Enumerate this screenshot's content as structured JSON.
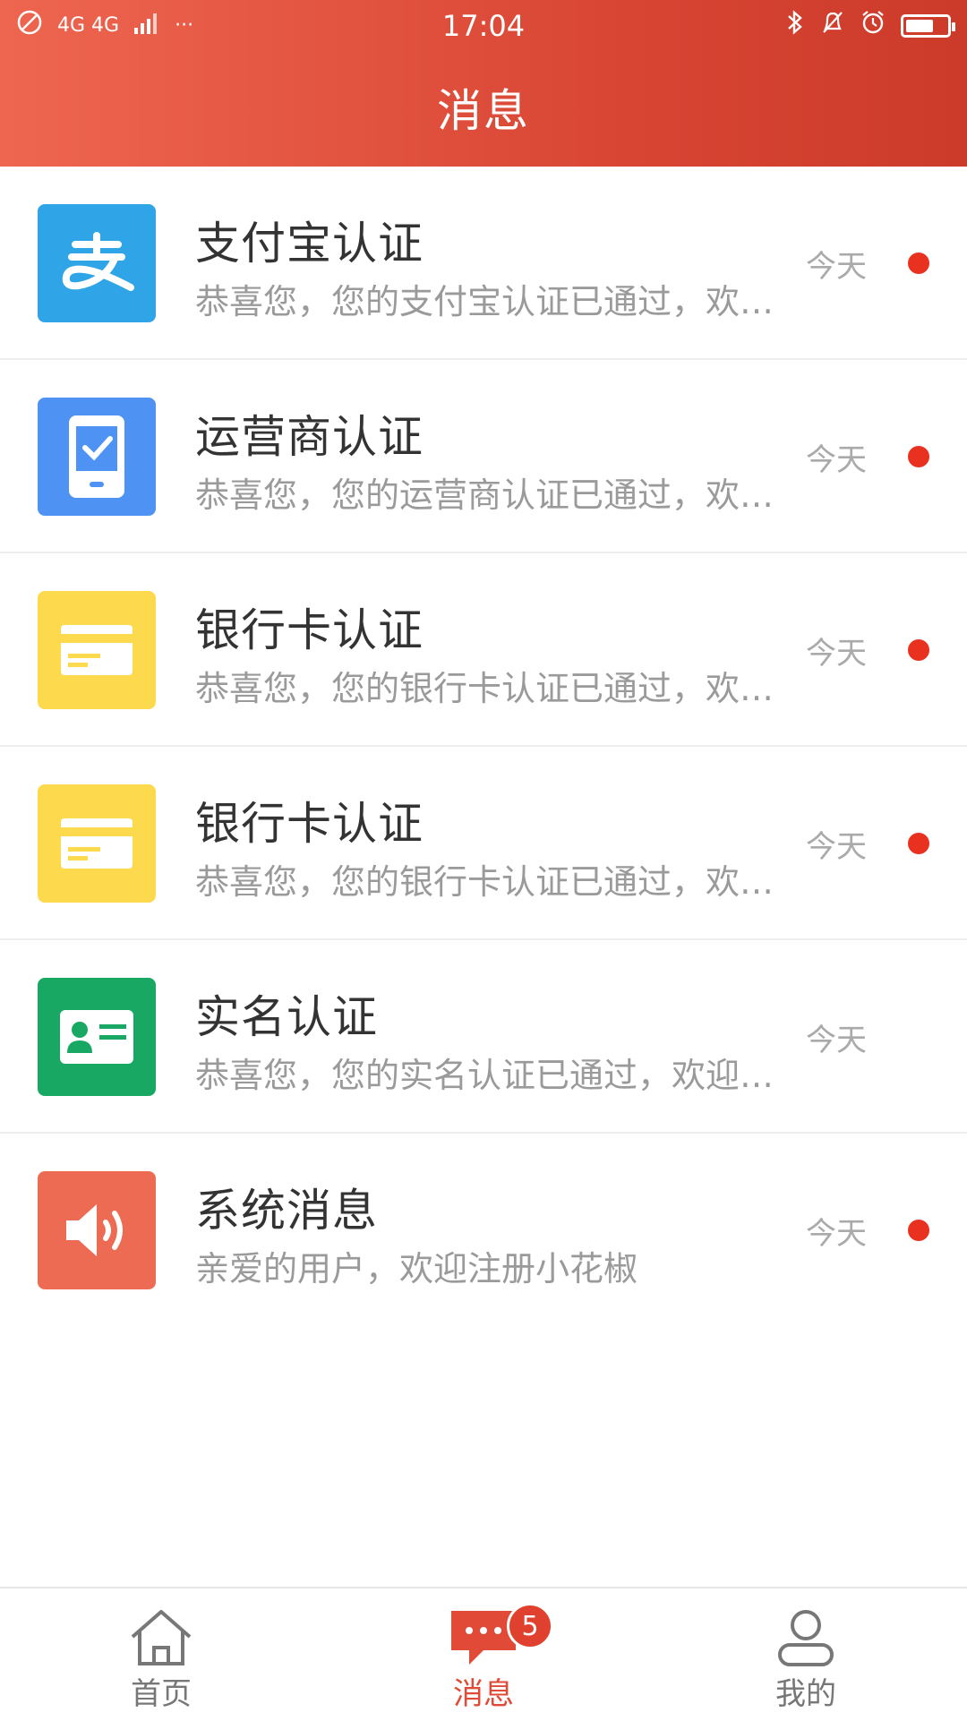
{
  "status_bar": {
    "time": "17:04",
    "network": "4G 4G",
    "more": "···"
  },
  "header": {
    "title": "消息"
  },
  "messages": [
    {
      "title": "支付宝认证",
      "subtitle": "恭喜您，您的支付宝认证已通过，欢迎使用",
      "time": "今天",
      "unread": true,
      "icon": "alipay-icon",
      "icon_color": "#2fa4e7"
    },
    {
      "title": "运营商认证",
      "subtitle": "恭喜您，您的运营商认证已通过，欢迎使用",
      "time": "今天",
      "unread": true,
      "icon": "phone-check-icon",
      "icon_color": "#4e93f4"
    },
    {
      "title": "银行卡认证",
      "subtitle": "恭喜您，您的银行卡认证已通过，欢迎使用",
      "time": "今天",
      "unread": true,
      "icon": "bank-card-icon",
      "icon_color": "#fdd94e"
    },
    {
      "title": "银行卡认证",
      "subtitle": "恭喜您，您的银行卡认证已通过，欢迎使用",
      "time": "今天",
      "unread": true,
      "icon": "bank-card-icon",
      "icon_color": "#fdd94e"
    },
    {
      "title": "实名认证",
      "subtitle": "恭喜您，您的实名认证已通过，欢迎使用",
      "time": "今天",
      "unread": false,
      "icon": "id-card-icon",
      "icon_color": "#19a864"
    },
    {
      "title": "系统消息",
      "subtitle": "亲爱的用户，欢迎注册小花椒",
      "time": "今天",
      "unread": true,
      "icon": "speaker-icon",
      "icon_color": "#ee6b53"
    }
  ],
  "tabbar": {
    "home_label": "首页",
    "messages_label": "消息",
    "messages_badge": "5",
    "profile_label": "我的",
    "active_color": "#e04a36"
  }
}
